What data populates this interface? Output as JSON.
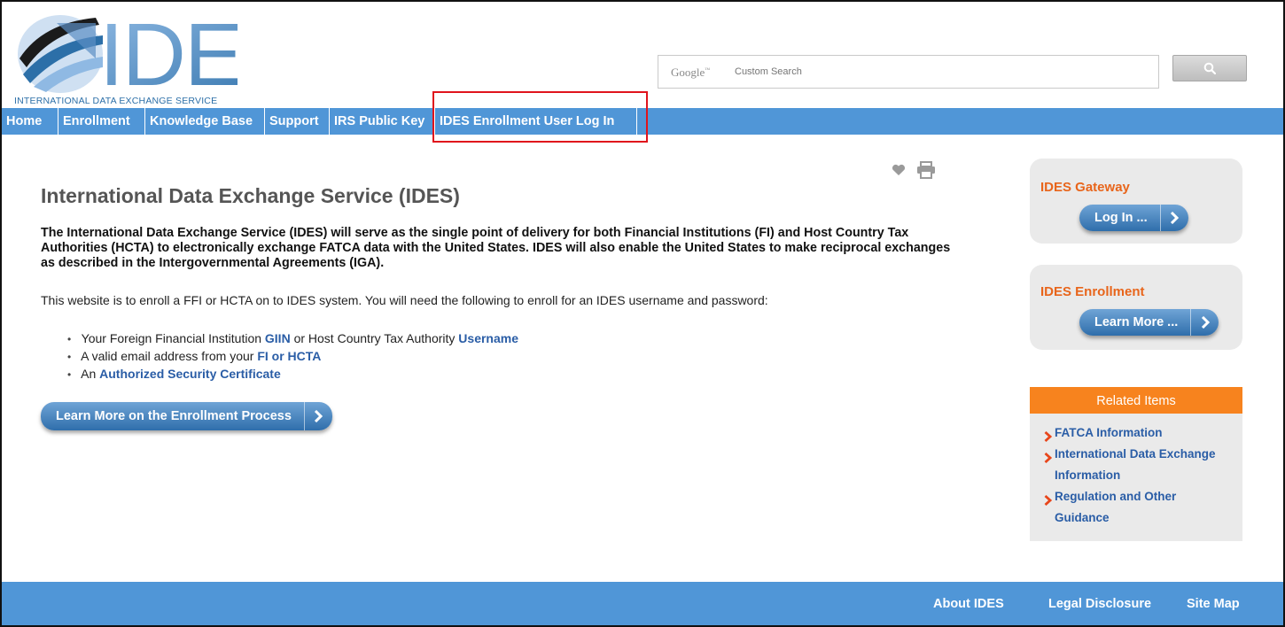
{
  "header": {
    "logo_text": "IDES",
    "logo_tagline": "INTERNATIONAL DATA EXCHANGE SERVICE",
    "search": {
      "brand": "Google",
      "placeholder": "Custom Search",
      "button_icon": "search-icon"
    }
  },
  "nav": {
    "items": [
      {
        "label": "Home"
      },
      {
        "label": "Enrollment"
      },
      {
        "label": "Knowledge Base"
      },
      {
        "label": "Support"
      },
      {
        "label": "IRS Public Key"
      },
      {
        "label": "IDES Enrollment User Log In"
      }
    ]
  },
  "main": {
    "tools": [
      "heart-icon",
      "print-icon"
    ],
    "title": "International Data Exchange Service (IDES)",
    "lead": "The International Data Exchange Service (IDES) will serve as the single point of delivery for both Financial Institutions (FI) and Host Country Tax Authorities (HCTA) to electronically exchange FATCA data with the United States. IDES will also enable the United States to make reciprocal exchanges as described in the Intergovernmental Agreements (IGA).",
    "intro": "This website is to enroll a FFI or HCTA on to IDES system. You will need the following to enroll for an IDES username and password:",
    "requirements": [
      {
        "pre": "Your Foreign Financial Institution ",
        "link1": "GIIN",
        "mid": " or Host Country Tax Authority ",
        "link2": "Username"
      },
      {
        "pre": "A valid email address from your ",
        "link1": "FI or HCTA"
      },
      {
        "pre": "An ",
        "link1": "Authorized Security Certificate"
      }
    ],
    "cta_label": "Learn More on the Enrollment Process"
  },
  "sidebar": {
    "gateway": {
      "title": "IDES Gateway",
      "button": "Log In ..."
    },
    "enrollment": {
      "title": "IDES Enrollment",
      "button": "Learn More ..."
    },
    "related": {
      "header": "Related Items",
      "items": [
        {
          "label": "FATCA Information"
        },
        {
          "label": "International Data Exchange Information"
        },
        {
          "label": "Regulation and Other Guidance"
        }
      ]
    }
  },
  "footer": {
    "links": [
      {
        "label": "About IDES"
      },
      {
        "label": "Legal Disclosure"
      },
      {
        "label": "Site Map"
      }
    ]
  },
  "colors": {
    "nav_blue": "#5096d7",
    "accent_orange": "#f7831e",
    "link_blue": "#2a5da6",
    "highlight_red": "#e0141c"
  }
}
